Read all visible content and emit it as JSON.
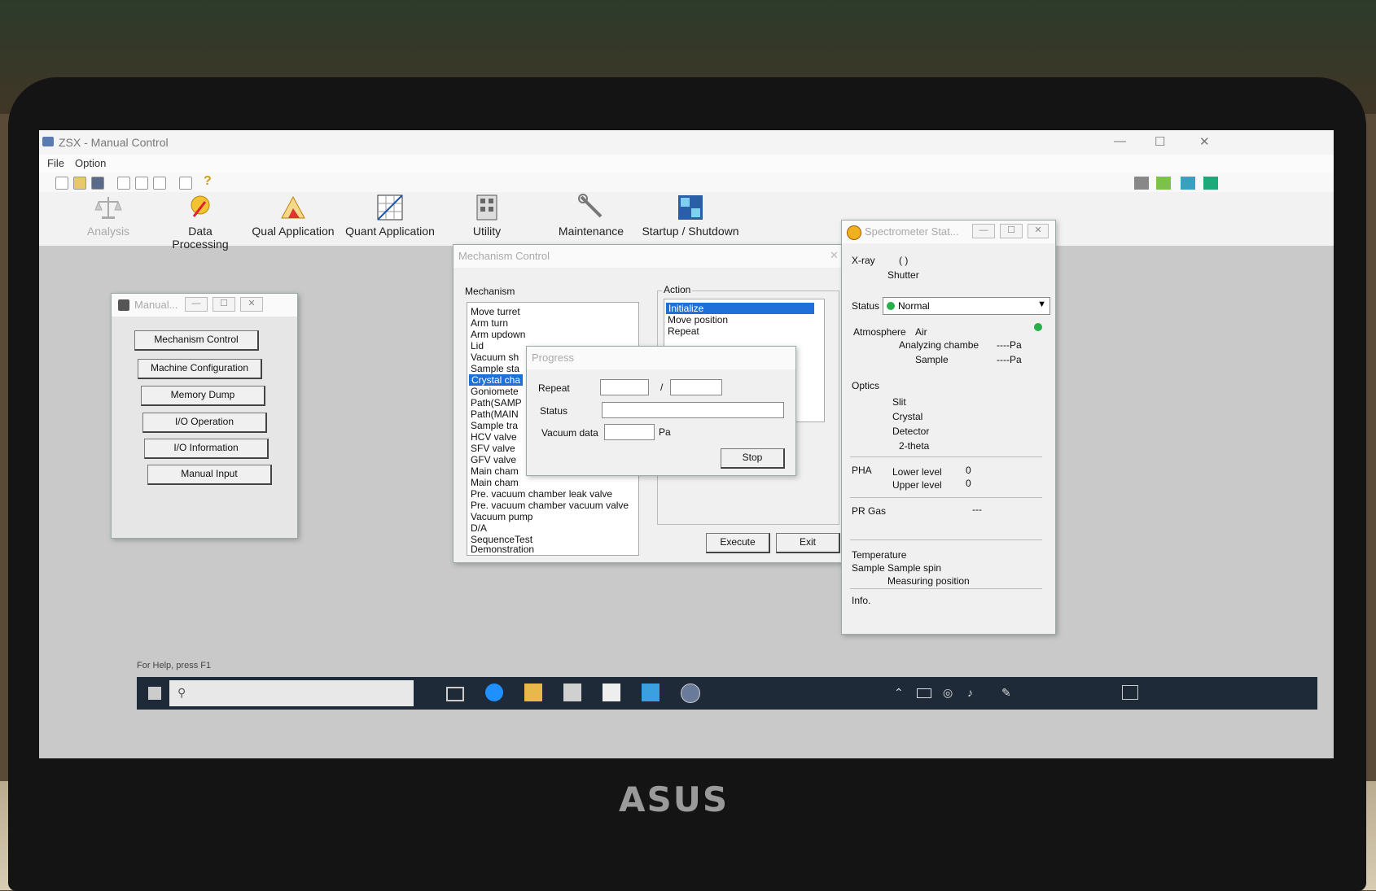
{
  "app": {
    "title": "ZSX - Manual Control",
    "menu": [
      "File",
      "Option"
    ],
    "ribbon": [
      "Analysis",
      "Data Processing",
      "Qual Application",
      "Quant Application",
      "Utility",
      "Maintenance",
      "Startup / Shutdown"
    ],
    "help_status": "For Help, press F1"
  },
  "manual_window": {
    "title": "Manual...",
    "buttons": [
      "Mechanism Control",
      "Machine Configuration",
      "Memory Dump",
      "I/O Operation",
      "I/O Information",
      "Manual Input"
    ]
  },
  "mechanism_window": {
    "title": "Mechanism Control",
    "mechanism_label": "Mechanism",
    "mechanism_items": [
      "Move turret",
      "Arm turn",
      "Arm updown",
      "Lid",
      "Vacuum sh",
      "Sample sta",
      "Crystal cha",
      "Goniomete",
      "Path(SAMP",
      "Path(MAIN",
      "Sample tra",
      "HCV valve",
      "SFV valve",
      "GFV valve",
      "Main cham",
      "Main cham",
      "Pre. vacuum chamber leak valve",
      "Pre. vacuum chamber vacuum valve",
      "Vacuum pump",
      "D/A",
      "SequenceTest",
      "Demonstration"
    ],
    "selected_mechanism": "Crystal cha",
    "action_label": "Action",
    "action_items": [
      "Initialize",
      "Move position",
      "Repeat"
    ],
    "selected_action": "Initialize",
    "execute_label": "Execute",
    "exit_label": "Exit"
  },
  "progress_dialog": {
    "title": "Progress",
    "repeat_label": "Repeat",
    "separator": "/",
    "status_label": "Status",
    "vacuum_label": "Vacuum data",
    "vacuum_unit": "Pa",
    "stop_label": "Stop"
  },
  "spectrometer": {
    "title": "Spectrometer Stat...",
    "xray_label": "X-ray",
    "xray_value": "( )",
    "shutter_label": "Shutter",
    "status_label": "Status",
    "status_value": "Normal",
    "atmosphere_label": "Atmosphere",
    "atmosphere_value": "Air",
    "analyzing_label": "Analyzing chambe",
    "analyzing_value": "----Pa",
    "sample_pressure_label": "Sample",
    "sample_pressure_value": "----Pa",
    "optics_label": "Optics",
    "optics_items": [
      "Slit",
      "Crystal",
      "Detector",
      "2-theta"
    ],
    "pha_label": "PHA",
    "lower_label": "Lower level",
    "lower_value": "0",
    "upper_label": "Upper level",
    "upper_value": "0",
    "prgas_label": "PR Gas",
    "prgas_value": "---",
    "temperature_label": "Temperature",
    "sample_label": "Sample",
    "sample_spin_label": "Sample spin",
    "measuring_label": "Measuring position",
    "info_label": "Info."
  },
  "laptop_brand": "ASUS",
  "colors": {
    "accent": "#1f6fd9",
    "status_ok": "#27b04a",
    "taskbar": "#1e2a38"
  }
}
